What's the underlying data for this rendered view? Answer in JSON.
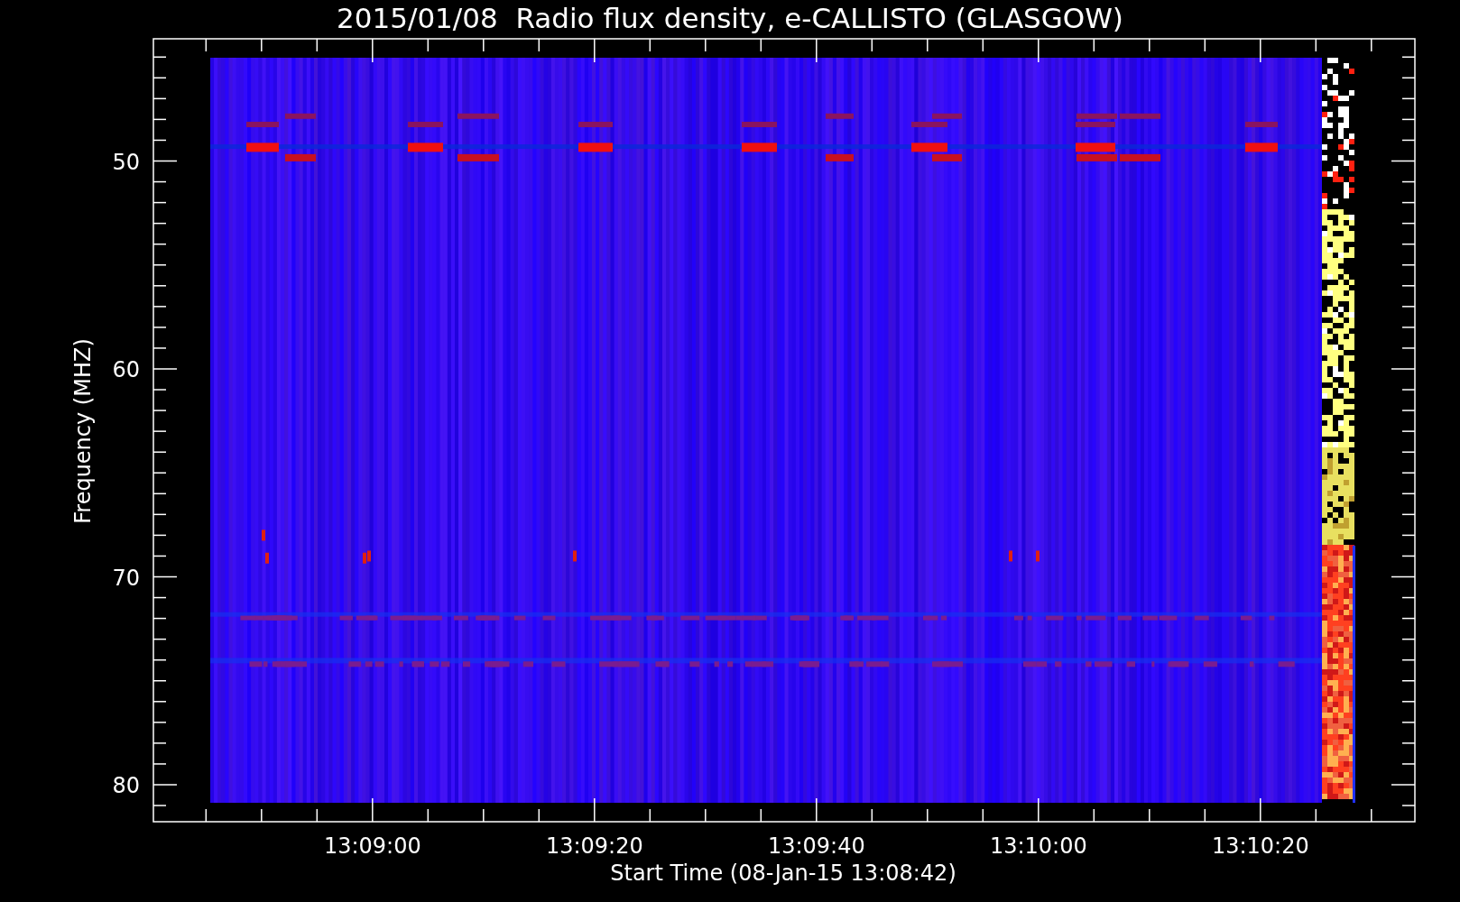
{
  "plot": {
    "title": "2015/01/08  Radio flux density, e-CALLISTO (GLASGOW)",
    "xlabel": "Start Time (08-Jan-15 13:08:42)",
    "ylabel": "Frequency (MHZ)",
    "xticks": [
      "13:09:00",
      "13:09:20",
      "13:09:40",
      "13:10:00",
      "13:10:20"
    ],
    "yticks": [
      "50",
      "60",
      "70",
      "80"
    ]
  }
}
